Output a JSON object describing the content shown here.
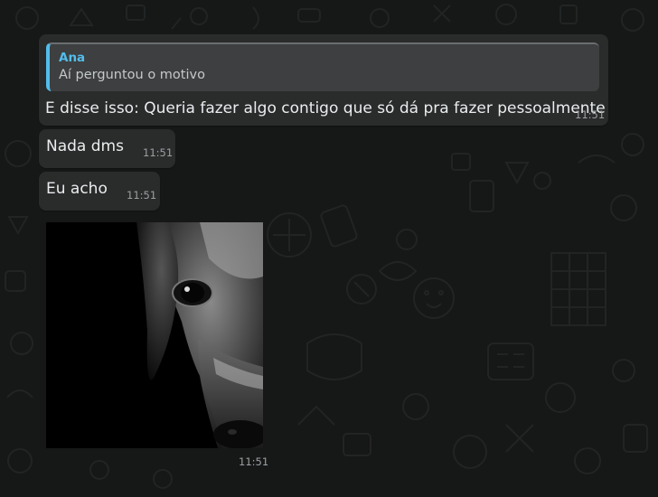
{
  "messages": [
    {
      "quote": {
        "author": "Ana",
        "text": "Aí perguntou o motivo"
      },
      "text": "E disse isso: Queria fazer algo contigo que só dá pra fazer pessoalmente",
      "time": "11:51"
    },
    {
      "text": "Nada dms",
      "time": "11:51"
    },
    {
      "text": "Eu acho",
      "time": "11:51"
    }
  ],
  "image_message": {
    "time": "11:51",
    "image_subject": "black-and-white dog photo"
  },
  "colors": {
    "background": "#161717",
    "bubble": "#2a2b2b",
    "quote_background": "#3d3f40",
    "quote_accent": "#53bdeb",
    "text": "#e9edef",
    "time": "#9aa0a3"
  }
}
